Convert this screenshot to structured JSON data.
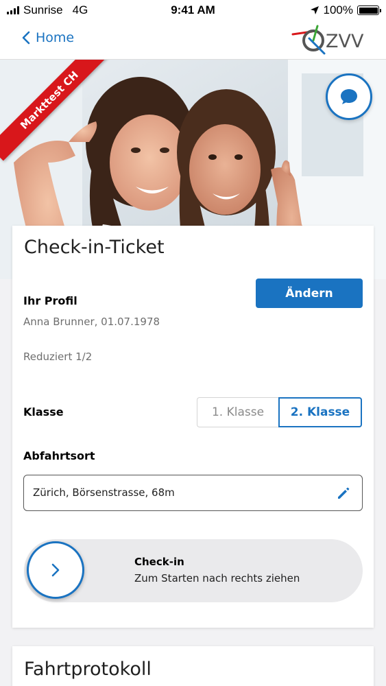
{
  "status_bar": {
    "carrier": "Sunrise",
    "network": "4G",
    "time": "9:41 AM",
    "battery": "100%",
    "battery_level": 1.0
  },
  "nav": {
    "back_label": "Home",
    "logo_text": "ZVV"
  },
  "hero": {
    "ribbon_text": "Markttest CH",
    "chat_icon": "chat-bubble-icon"
  },
  "ticket": {
    "title": "Check-in-Ticket",
    "profile_heading": "Ihr Profil",
    "change_button": "Ändern",
    "profile_name": "Anna Brunner, 01.07.1978",
    "profile_type": "Reduziert 1/2",
    "class_label": "Klasse",
    "class_options": [
      "1. Klasse",
      "2. Klasse"
    ],
    "class_selected": "2. Klasse",
    "departure_label": "Abfahrtsort",
    "departure_value": "Zürich, Börsenstrasse, 68m",
    "checkin_title": "Check-in",
    "checkin_hint": "Zum Starten nach rechts ziehen"
  },
  "protocol": {
    "title": "Fahrtprotokoll"
  },
  "colors": {
    "accent": "#1a73c1",
    "ribbon": "#d8171b"
  }
}
